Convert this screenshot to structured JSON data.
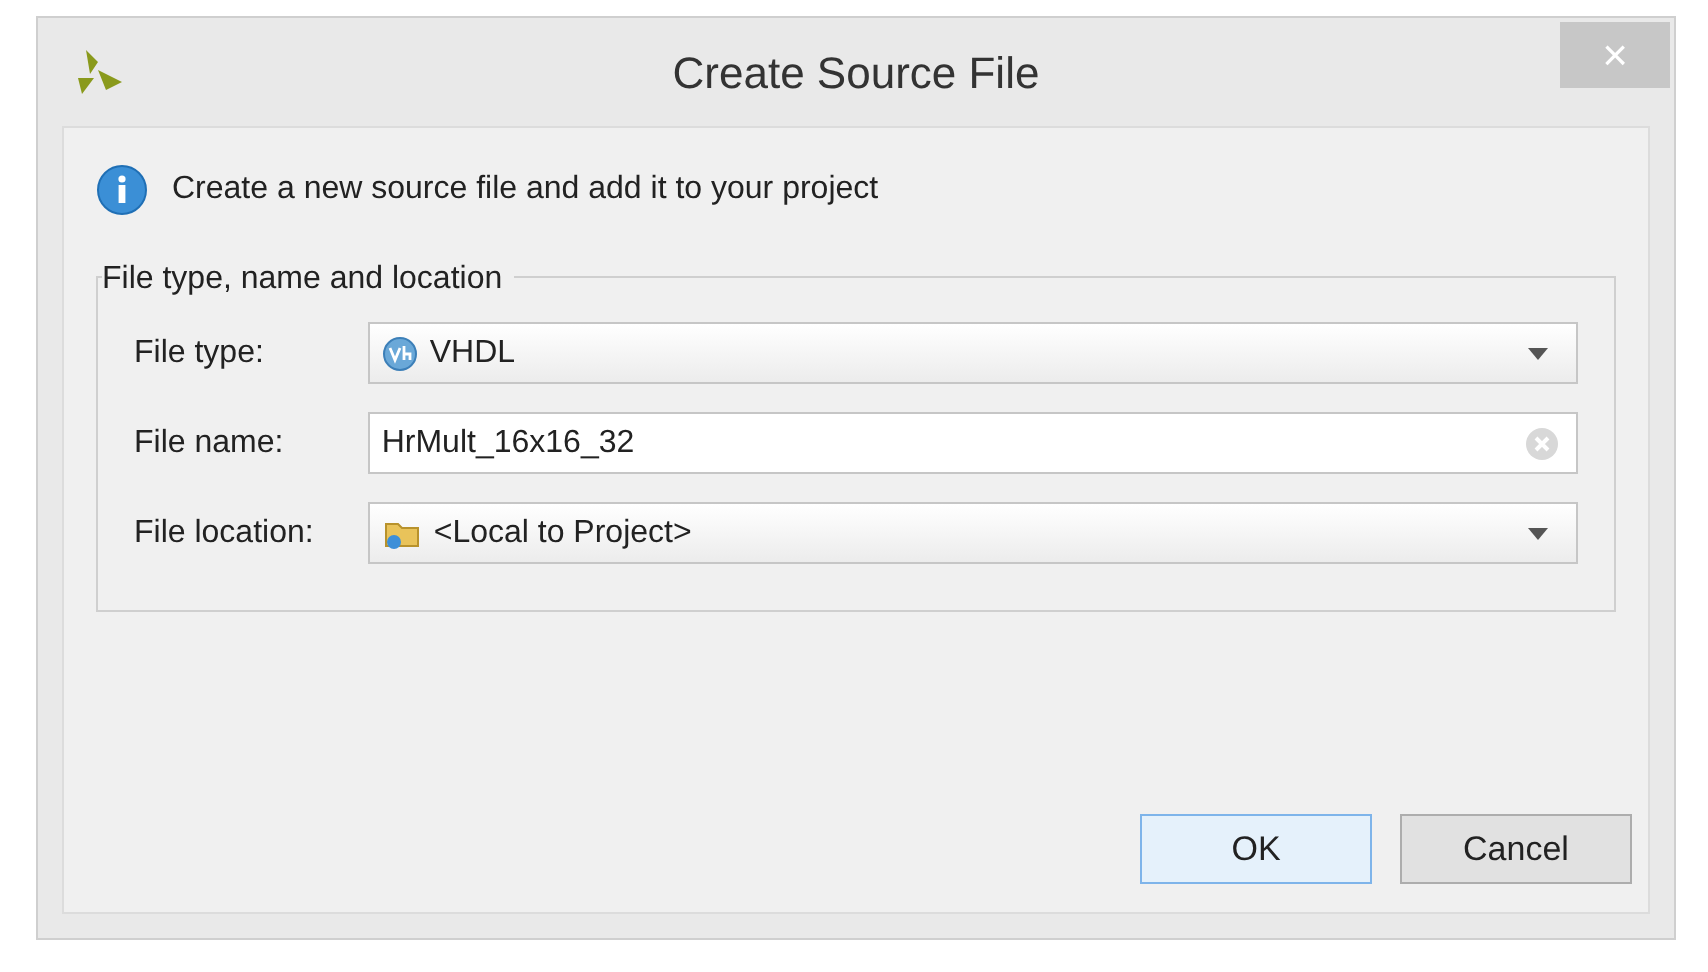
{
  "window": {
    "title": "Create Source File",
    "close_label": "×"
  },
  "info": {
    "text": "Create a new source file and add it to your project"
  },
  "group": {
    "title": "File type, name and location",
    "fields": [
      {
        "kind": "dropdown",
        "label": "File type:",
        "value": "VHDL"
      },
      {
        "kind": "text",
        "label": "File name:",
        "value": "HrMult_16x16_32"
      },
      {
        "kind": "dropdown",
        "label": "File location:",
        "value": "<Local to Project>"
      }
    ]
  },
  "buttons": [
    {
      "label": "OK",
      "default": true
    },
    {
      "label": "Cancel",
      "default": false
    }
  ]
}
